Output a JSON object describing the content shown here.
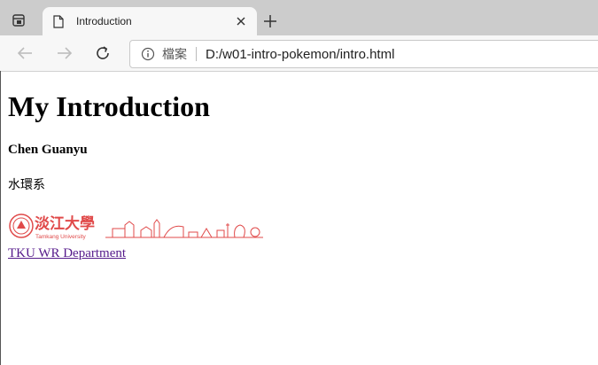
{
  "browser": {
    "tab": {
      "title": "Introduction"
    },
    "address_bar": {
      "chip": "檔案",
      "url": "D:/w01-intro-pokemon/intro.html"
    }
  },
  "page": {
    "heading": "My Introduction",
    "name": "Chen Guanyu",
    "department": "水環系",
    "logo": {
      "chinese_text": "淡江大學",
      "english_text": "Tamkang University",
      "color": "#e04a4a"
    },
    "link_text": "TKU WR Department"
  },
  "colors": {
    "tabbar_bg": "#cccccc",
    "toolbar_bg": "#f7f7f7",
    "visited_link": "#551a8b",
    "logo_red": "#e04a4a"
  }
}
